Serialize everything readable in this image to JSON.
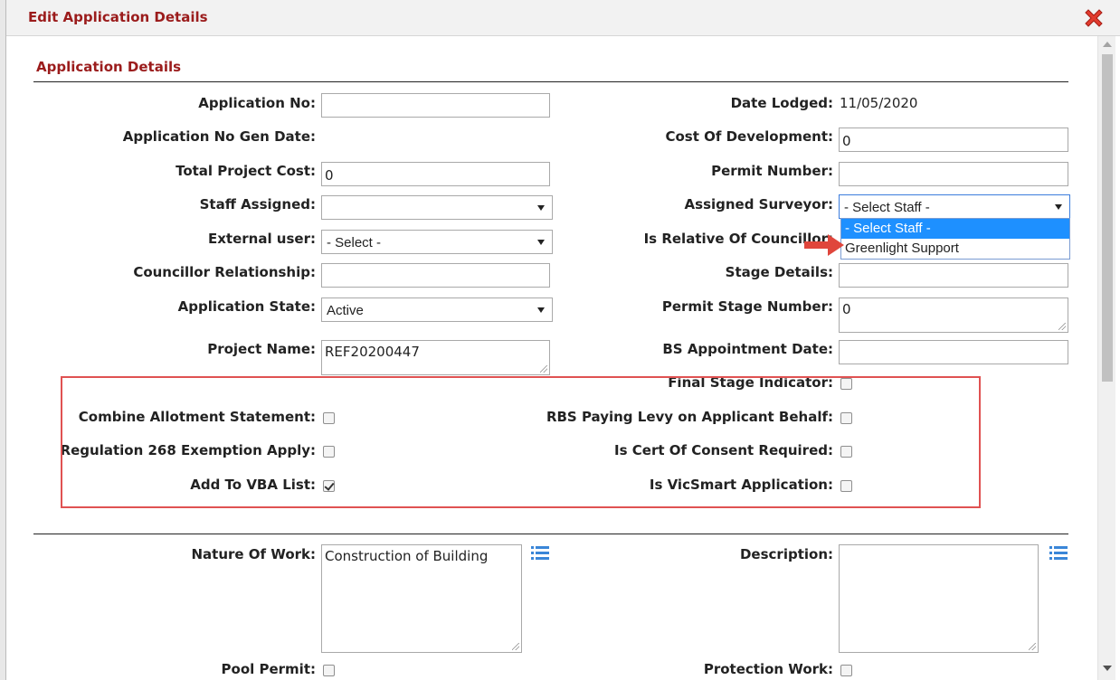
{
  "dialog": {
    "title": "Edit Application Details"
  },
  "section": {
    "title": "Application Details"
  },
  "fields": {
    "application_no": {
      "label": "Application No:",
      "value": ""
    },
    "date_lodged": {
      "label": "Date Lodged:",
      "value": "11/05/2020"
    },
    "app_no_gen_date": {
      "label": "Application No Gen Date:"
    },
    "cost_of_development": {
      "label": "Cost Of Development:",
      "value": "0"
    },
    "total_project_cost": {
      "label": "Total Project Cost:",
      "value": "0"
    },
    "permit_number": {
      "label": "Permit Number:",
      "value": ""
    },
    "staff_assigned": {
      "label": "Staff Assigned:",
      "value": ""
    },
    "assigned_surveyor": {
      "label": "Assigned Surveyor:",
      "value": "- Select Staff -",
      "options": [
        "- Select Staff -",
        "Greenlight Support"
      ]
    },
    "external_user": {
      "label": "External user:",
      "value": "- Select -"
    },
    "is_relative_of_councillor": {
      "label": "Is Relative Of Councillor:"
    },
    "councillor_relationship": {
      "label": "Councillor Relationship:",
      "value": ""
    },
    "stage_details": {
      "label": "Stage Details:",
      "value": ""
    },
    "application_state": {
      "label": "Application State:",
      "value": "Active"
    },
    "permit_stage_number": {
      "label": "Permit Stage Number:",
      "value": "0"
    },
    "project_name": {
      "label": "Project Name:",
      "value": "REF20200447"
    },
    "bs_appointment_date": {
      "label": "BS Appointment Date:",
      "value": ""
    },
    "final_stage_indicator": {
      "label": "Final Stage Indicator:",
      "checked": false
    },
    "combine_allotment_statement": {
      "label": "Combine Allotment Statement:",
      "checked": false
    },
    "rbs_paying_levy": {
      "label": "RBS Paying Levy on Applicant Behalf:",
      "checked": false
    },
    "regulation_268": {
      "label": "Regulation 268 Exemption Apply:",
      "checked": false
    },
    "is_cert_of_consent": {
      "label": "Is Cert Of Consent Required:",
      "checked": false
    },
    "add_to_vba_list": {
      "label": "Add To VBA List:",
      "checked": true
    },
    "is_vicsmart": {
      "label": "Is VicSmart Application:",
      "checked": false
    },
    "nature_of_work": {
      "label": "Nature Of Work:",
      "value": "Construction of Building"
    },
    "description": {
      "label": "Description:",
      "value": ""
    },
    "pool_permit": {
      "label": "Pool Permit:",
      "checked": false
    },
    "protection_work": {
      "label": "Protection Work:",
      "checked": false
    }
  },
  "colors": {
    "title": "#9b1c1c",
    "highlight_box": "#e05252",
    "selected_option": "#1e90ff",
    "list_icon": "#3a86d8"
  },
  "icons": {
    "close": "close-x-icon",
    "list": "list-icon",
    "annotation": "red-arrow-icon"
  }
}
